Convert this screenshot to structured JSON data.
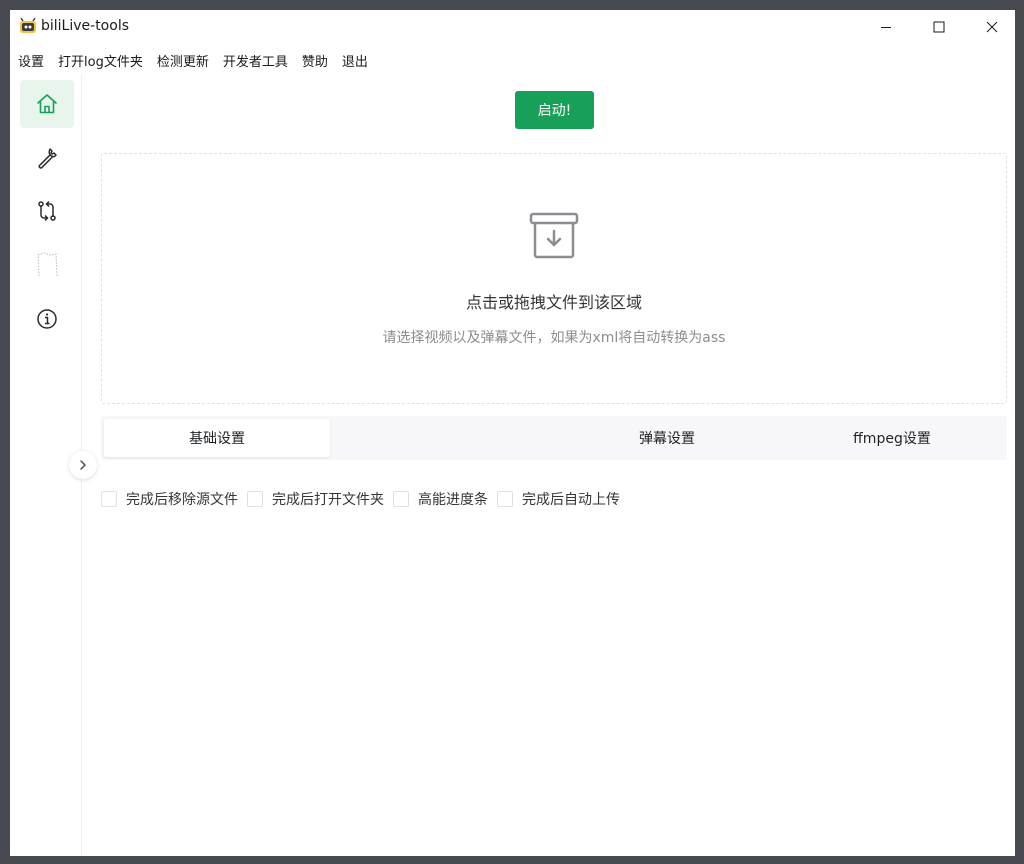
{
  "window": {
    "title": "biliLive-tools"
  },
  "menu": [
    "设置",
    "打开log文件夹",
    "检测更新",
    "开发者工具",
    "赞助",
    "退出"
  ],
  "sidebar": {
    "items": [
      {
        "icon": "home-icon",
        "active": true
      },
      {
        "icon": "wrench-icon",
        "active": false
      },
      {
        "icon": "git-compare-icon",
        "active": false
      },
      {
        "icon": "outline-icon",
        "active": false
      },
      {
        "icon": "info-icon",
        "active": false
      }
    ]
  },
  "main": {
    "start_label": "启动!",
    "dropzone": {
      "title": "点击或拖拽文件到该区域",
      "subtitle": "请选择视频以及弹幕文件，如果为xml将自动转换为ass"
    },
    "tabs": [
      {
        "label": "基础设置",
        "active": true
      },
      {
        "label": "弹幕设置",
        "active": false
      },
      {
        "label": "ffmpeg设置",
        "active": false
      }
    ],
    "options": [
      {
        "label": "完成后移除源文件",
        "checked": false
      },
      {
        "label": "完成后打开文件夹",
        "checked": false
      },
      {
        "label": "高能进度条",
        "checked": false
      },
      {
        "label": "完成后自动上传",
        "checked": false
      }
    ]
  },
  "colors": {
    "accent": "#18a058",
    "active_bg": "#e7f5ec",
    "backdrop": "#474b51"
  }
}
